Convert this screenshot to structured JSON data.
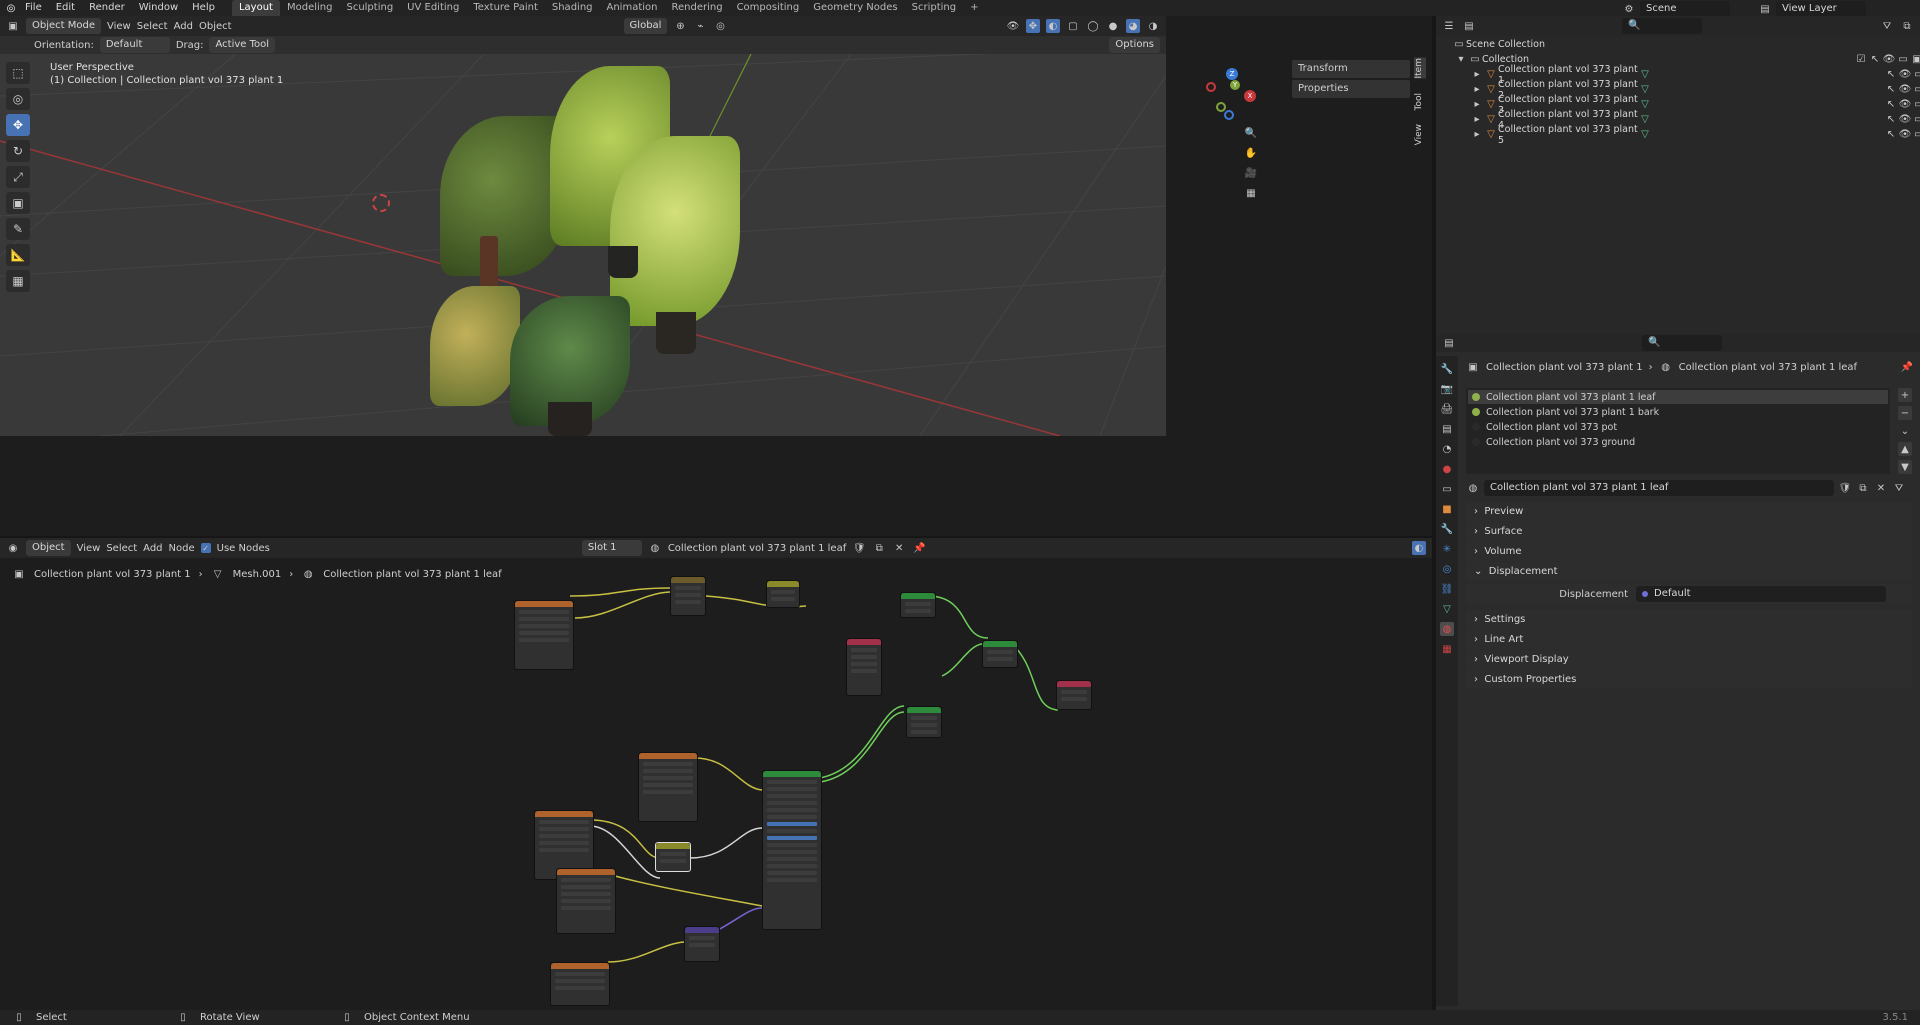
{
  "menubar": {
    "menus": [
      "File",
      "Edit",
      "Render",
      "Window",
      "Help"
    ],
    "workspaces": [
      "Layout",
      "Modeling",
      "Sculpting",
      "UV Editing",
      "Texture Paint",
      "Shading",
      "Animation",
      "Rendering",
      "Compositing",
      "Geometry Nodes",
      "Scripting"
    ],
    "active_workspace": "Layout",
    "scene_label": "Scene",
    "view_layer_label": "View Layer"
  },
  "viewport_header": {
    "mode": "Object Mode",
    "menus": [
      "View",
      "Select",
      "Add",
      "Object"
    ],
    "transform_orientation": "Global",
    "orientation_label": "Orientation:",
    "orientation_value": "Default",
    "drag_label": "Drag:",
    "drag_value": "Active Tool",
    "options": "Options"
  },
  "viewport": {
    "perspective": "User Perspective",
    "collection_info": "(1) Collection | Collection plant vol 373 plant 1",
    "n_panel": {
      "transform": "Transform",
      "properties": "Properties"
    },
    "side_tabs": [
      "Item",
      "Tool",
      "View"
    ],
    "gizmo_axes": {
      "x": "X",
      "y": "Y",
      "z": "Z"
    }
  },
  "node_editor": {
    "header": {
      "object_menu": "Object",
      "menus": [
        "View",
        "Select",
        "Add",
        "Node"
      ],
      "use_nodes": "Use Nodes",
      "slot": "Slot 1",
      "material": "Collection plant vol 373 plant 1 leaf"
    },
    "breadcrumb": [
      "Collection plant vol 373 plant 1",
      "Mesh.001",
      "Collection plant vol 373 plant 1 leaf"
    ]
  },
  "outliner": {
    "scene_collection": "Scene Collection",
    "collection": "Collection",
    "items": [
      "Collection plant vol 373 plant 1",
      "Collection plant vol 373 plant 2",
      "Collection plant vol 373 plant 3",
      "Collection plant vol 373 plant 4",
      "Collection plant vol 373 plant 5"
    ]
  },
  "properties": {
    "breadcrumb_object": "Collection plant vol 373 plant 1",
    "breadcrumb_material": "Collection plant vol 373 plant 1 leaf",
    "material_slots": [
      {
        "name": "Collection plant vol 373 plant 1 leaf",
        "color": "#8fb04a"
      },
      {
        "name": "Collection plant vol 373 plant 1 bark",
        "color": "#8fb04a"
      },
      {
        "name": "Collection plant vol 373 pot",
        "color": "#2a2a2a"
      },
      {
        "name": "Collection plant vol 373 ground",
        "color": "#2a2a2a"
      }
    ],
    "material_name": "Collection plant vol 373 plant 1 leaf",
    "sections": [
      "Preview",
      "Surface",
      "Volume",
      "Displacement",
      "Settings",
      "Line Art",
      "Viewport Display",
      "Custom Properties"
    ],
    "displacement_label": "Displacement",
    "displacement_value": "Default"
  },
  "statusbar": {
    "select": "Select",
    "rotate": "Rotate View",
    "context": "Object Context Menu",
    "version": "3.5.1"
  },
  "colors": {
    "accent": "#4772b3",
    "x_axis": "#c9383b",
    "y_axis": "#7ea53b",
    "z_axis": "#3b7bd8"
  }
}
